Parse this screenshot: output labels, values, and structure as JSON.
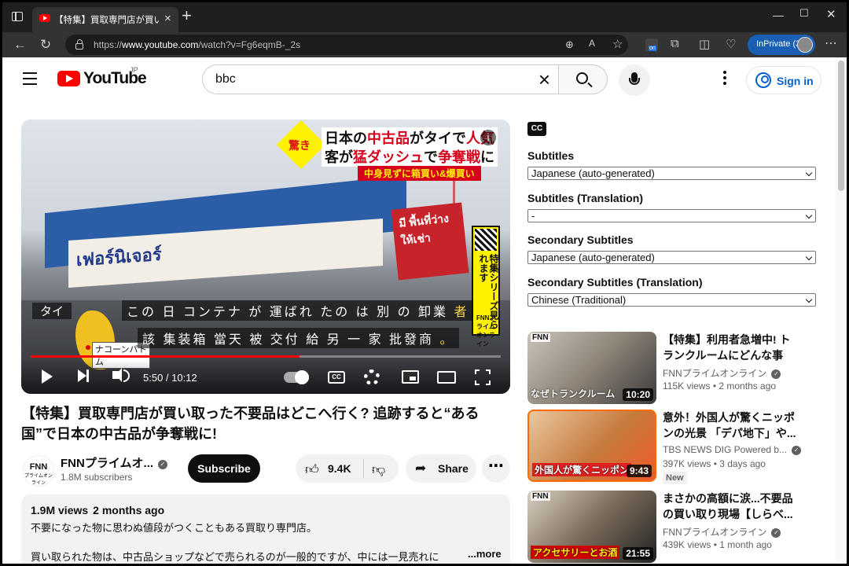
{
  "browser": {
    "tab_title": "【特集】買取専門店が買い取った不要",
    "url_prefix": "https://",
    "url_host": "www.youtube.com",
    "url_path": "/watch?v=Fg6eqmB-_2s",
    "inprivate_label": "InPrivate (3)"
  },
  "masthead": {
    "logo_text": "YouTube",
    "country": "JP",
    "search_value": "bbc",
    "signin_label": "Sign in"
  },
  "player": {
    "headline_burst": "驚き",
    "headline_line1_a": "日本の",
    "headline_line1_b": "中古品",
    "headline_line1_c": "がタイで",
    "headline_line1_d": "人気",
    "headline_line2_a": "客が",
    "headline_line2_b": "猛ダッシュ",
    "headline_line2_c": "で",
    "headline_line2_d": "争奪戦",
    "headline_line2_e": "に",
    "headline_sub": "中身見ずに箱買い&爆買い",
    "side_tag_text": "特集シリーズ見られます",
    "side_tag_fnn": "FNNプライムオンライン",
    "map_label": "タイ",
    "map_city": "ナコーンパトム",
    "store_sign_thai": "เฟอร์นิเจอร์",
    "red_sign_thai": "มี พื้นที่ว่าง ให้เช่า",
    "caption1_main": "この 日 コンテナ が 運ばれ たの は 別 の 卸業",
    "caption1_hl": "者",
    "caption2_main": "該 集装箱 當天 被 交付 給 另 一 家 批發商",
    "caption2_hl": "。",
    "time_current": "5:50",
    "time_total": "10:12",
    "time_display": "5:50 / 10:12",
    "progress_fraction": 0.572,
    "cc_label": "CC"
  },
  "video": {
    "title": "【特集】買取専門店が買い取った不要品はどこへ行く? 追跡すると“ある国”で日本の中古品が争奪戦に!",
    "channel_logo": "FNN",
    "channel_logo_sub": "プライムオンライン",
    "channel_name": "FNNプライムオ...",
    "subscribers": "1.8M subscribers",
    "subscribe_label": "Subscribe",
    "likes": "9.4K",
    "share_label": "Share",
    "views": "1.9M views",
    "age": "2 months ago",
    "desc_line1": "不要になった物に思わぬ値段がつくこともある買取り専門店。",
    "desc_line2": "買い取られた物は、中古品ショップなどで売られるのが一般的ですが、中には一見売れに",
    "desc_more": "...more"
  },
  "subtitles_panel": {
    "cc_badge": "CC",
    "fields": [
      {
        "label": "Subtitles",
        "value": "Japanese (auto-generated)"
      },
      {
        "label": "Subtitles (Translation)",
        "value": "-"
      },
      {
        "label": "Secondary Subtitles",
        "value": "Japanese (auto-generated)"
      },
      {
        "label": "Secondary Subtitles (Translation)",
        "value": "Chinese (Traditional)"
      }
    ]
  },
  "recommendations": [
    {
      "title": "【特集】利用者急増中! トランクルームにどんな事情...",
      "channel": "FNNプライムオンライン",
      "views": "115K views",
      "age": "2 months ago",
      "duration": "10:20",
      "thumb_caption": "なぜトランクルーム",
      "thumb_logo": "FNN"
    },
    {
      "title": "意外！外国人が驚くニッポンの光景 「デパ地下」や...",
      "channel": "TBS NEWS DIG Powered b...",
      "views": "397K views",
      "age": "3 days ago",
      "duration": "9:43",
      "thumb_caption": "外国人が驚くニッポン",
      "badge": "New"
    },
    {
      "title": "まさかの高額に涙...不要品の買い取り現場【しらべ...",
      "channel": "FNNプライムオンライン",
      "views": "439K views",
      "age": "1 month ago",
      "duration": "21:55",
      "thumb_caption": "アクセサリーとお酒",
      "thumb_logo": "FNN"
    }
  ],
  "colors": {
    "yt_red": "#ff0000",
    "link_blue": "#065fd4",
    "inprivate_blue": "#1a5fb4"
  }
}
